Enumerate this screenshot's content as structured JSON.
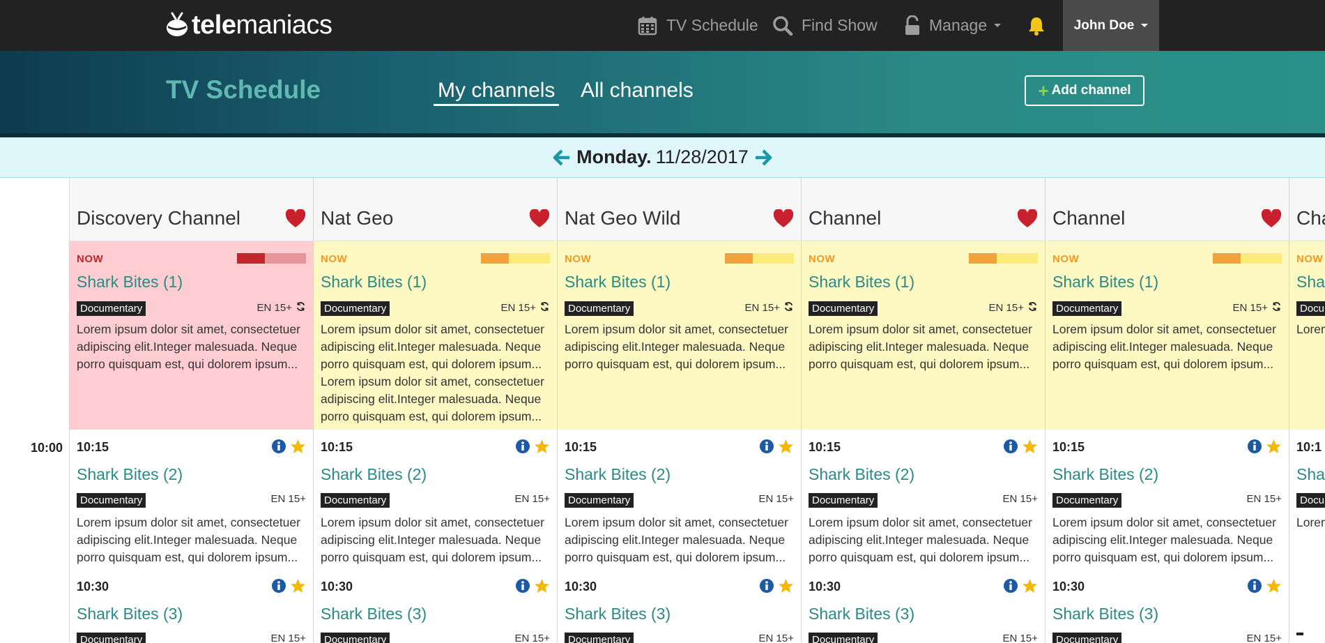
{
  "app": {
    "logo_text_bold": "tele",
    "logo_text_rest": "maniacs"
  },
  "nav": {
    "tv_schedule": "TV Schedule",
    "find_show": "Find Show",
    "manage": "Manage",
    "user": "John Doe"
  },
  "header": {
    "title": "TV Schedule",
    "tab_my_channels": "My channels",
    "tab_all_channels": "All channels",
    "add_channel": "Add channel"
  },
  "date": {
    "day_of_week": "Monday.",
    "date": "11/28/2017"
  },
  "timeline": {
    "label_1000": "10:00"
  },
  "channels": [
    {
      "name": "Discovery Channel",
      "now": {
        "label": "NOW",
        "progress": 0.4,
        "title": "Shark Bites (1)",
        "genre": "Documentary",
        "rating": "EN 15+",
        "desc": "Lorem ipsum dolor sit amet, consectetuer adipiscing elit.Integer malesuada. Neque porro quisquam est, qui dolorem ipsum..."
      },
      "slots": [
        {
          "time": "10:15",
          "title": "Shark Bites (2)",
          "genre": "Documentary",
          "rating": "EN 15+",
          "desc": "Lorem ipsum dolor sit amet, consectetuer adipiscing elit.Integer malesuada. Neque porro quisquam est, qui dolorem ipsum..."
        },
        {
          "time": "10:30",
          "title": "Shark Bites (3)",
          "genre": "Documentary",
          "rating": "EN 15+"
        }
      ]
    },
    {
      "name": "Nat Geo",
      "now": {
        "label": "NOW",
        "progress": 0.4,
        "title": "Shark Bites (1)",
        "genre": "Documentary",
        "rating": "EN 15+",
        "desc": "Lorem ipsum dolor sit amet, consectetuer adipiscing elit.Integer malesuada. Neque porro quisquam est, qui dolorem ipsum... Lorem ipsum dolor sit amet, consectetuer adipiscing elit.Integer malesuada. Neque porro quisquam est, qui dolorem ipsum..."
      },
      "slots": [
        {
          "time": "10:15",
          "title": "Shark Bites (2)",
          "genre": "Documentary",
          "rating": "EN 15+",
          "desc": "Lorem ipsum dolor sit amet, consectetuer adipiscing elit.Integer malesuada. Neque porro quisquam est, qui dolorem ipsum..."
        },
        {
          "time": "10:30",
          "title": "Shark Bites (3)",
          "genre": "Documentary",
          "rating": "EN 15+"
        }
      ]
    },
    {
      "name": "Nat Geo Wild",
      "now": {
        "label": "NOW",
        "progress": 0.4,
        "title": "Shark Bites (1)",
        "genre": "Documentary",
        "rating": "EN 15+",
        "desc": "Lorem ipsum dolor sit amet, consectetuer adipiscing elit.Integer malesuada. Neque porro quisquam est, qui dolorem ipsum..."
      },
      "slots": [
        {
          "time": "10:15",
          "title": "Shark Bites (2)",
          "genre": "Documentary",
          "rating": "EN 15+",
          "desc": "Lorem ipsum dolor sit amet, consectetuer adipiscing elit.Integer malesuada. Neque porro quisquam est, qui dolorem ipsum..."
        },
        {
          "time": "10:30",
          "title": "Shark Bites (3)",
          "genre": "Documentary",
          "rating": "EN 15+"
        }
      ]
    },
    {
      "name": "Channel",
      "now": {
        "label": "NOW",
        "progress": 0.4,
        "title": "Shark Bites (1)",
        "genre": "Documentary",
        "rating": "EN 15+",
        "desc": "Lorem ipsum dolor sit amet, consectetuer adipiscing elit.Integer malesuada. Neque porro quisquam est, qui dolorem ipsum..."
      },
      "slots": [
        {
          "time": "10:15",
          "title": "Shark Bites (2)",
          "genre": "Documentary",
          "rating": "EN 15+",
          "desc": "Lorem ipsum dolor sit amet, consectetuer adipiscing elit.Integer malesuada. Neque porro quisquam est, qui dolorem ipsum..."
        },
        {
          "time": "10:30",
          "title": "Shark Bites (3)",
          "genre": "Documentary",
          "rating": "EN 15+"
        }
      ]
    },
    {
      "name": "Channel",
      "now": {
        "label": "NOW",
        "progress": 0.4,
        "title": "Shark Bites (1)",
        "genre": "Documentary",
        "rating": "EN 15+",
        "desc": "Lorem ipsum dolor sit amet, consectetuer adipiscing elit.Integer malesuada. Neque porro quisquam est, qui dolorem ipsum..."
      },
      "slots": [
        {
          "time": "10:15",
          "title": "Shark Bites (2)",
          "genre": "Documentary",
          "rating": "EN 15+",
          "desc": "Lorem ipsum dolor sit amet, consectetuer adipiscing elit.Integer malesuada. Neque porro quisquam est, qui dolorem ipsum..."
        },
        {
          "time": "10:30",
          "title": "Shark Bites (3)",
          "genre": "Documentary",
          "rating": "EN 15+"
        }
      ]
    },
    {
      "name": "Cha",
      "now": {
        "label": "NOW",
        "title": "Shar",
        "genre": "Docu",
        "desc": "Lorem adipis porro"
      },
      "slots": [
        {
          "time": "10:1",
          "title": "Shar",
          "genre": "Docu",
          "desc": "Lorem adipis porro"
        },
        {
          "time": "",
          "title": "",
          "genre": ""
        }
      ]
    }
  ],
  "colors": {
    "navbar": "#222222",
    "accent_teal": "#2a8a85",
    "heart": "#c9202d",
    "star": "#f5b800",
    "info": "#1c5aa6",
    "bell": "#f5c518",
    "now_red_bg": "#fdcdd2",
    "now_yellow_bg": "#fef8c3"
  },
  "icons": {
    "tv_schedule": "calendar-icon",
    "find_show": "search-icon",
    "manage": "unlock-icon",
    "notifications": "bell-icon",
    "favorite": "heart-icon",
    "info": "info-icon",
    "star": "star-icon",
    "repeat": "refresh-icon"
  }
}
